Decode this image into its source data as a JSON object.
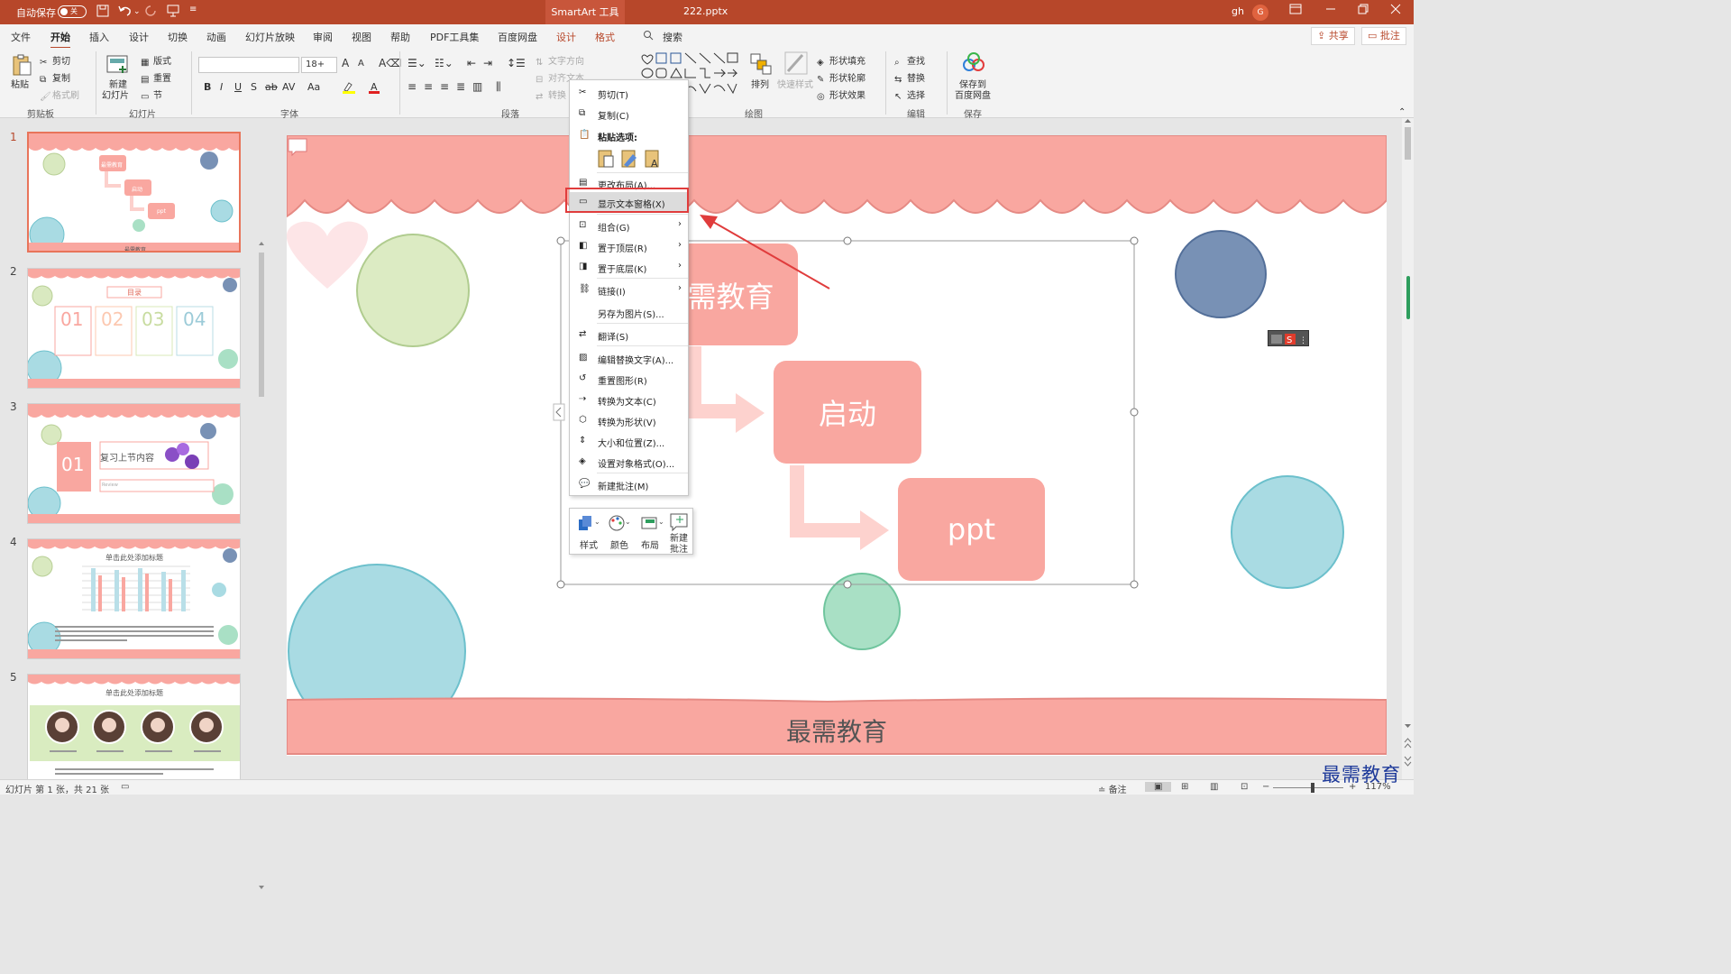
{
  "titlebar": {
    "autosave_label": "自动保存",
    "autosave_state": "关",
    "context_tab": "SmartArt 工具",
    "filename": "222.pptx",
    "user": "gh",
    "avatar_letter": "G"
  },
  "menu": {
    "tabs": [
      "文件",
      "开始",
      "插入",
      "设计",
      "切换",
      "动画",
      "幻灯片放映",
      "审阅",
      "视图",
      "帮助",
      "PDF工具集",
      "百度网盘",
      "设计",
      "格式"
    ],
    "search": "搜索",
    "share": "共享",
    "comment": "批注"
  },
  "ribbon": {
    "clipboard": {
      "paste": "粘贴",
      "cut": "剪切",
      "copy": "复制",
      "format_painter": "格式刷",
      "label": "剪贴板"
    },
    "slides": {
      "new_slide_1": "新建",
      "new_slide_2": "幻灯片",
      "layout": "版式",
      "reset": "重置",
      "section": "节",
      "label": "幻灯片"
    },
    "font": {
      "size": "18+",
      "label": "字体",
      "bold": "B",
      "italic": "I",
      "underline": "U",
      "strike": "S",
      "strike2": "ab",
      "spacing": "AV",
      "case": "Aa",
      "grow": "A",
      "shrink": "A"
    },
    "paragraph": {
      "text_direction": "文字方向",
      "align_text": "对齐文本",
      "convert": "转换",
      "label": "段落"
    },
    "drawing": {
      "arrange": "排列",
      "quick_styles": "快速样式",
      "shape_fill": "形状填充",
      "shape_outline": "形状轮廓",
      "shape_effects": "形状效果",
      "label": "绘图"
    },
    "editing": {
      "find": "查找",
      "replace": "替换",
      "select": "选择",
      "label": "编辑"
    },
    "save": {
      "line1": "保存到",
      "line2": "百度网盘",
      "label": "保存"
    }
  },
  "thumbnails": [
    {
      "num": "1",
      "title": "最需教育",
      "node2": "启动",
      "node3": "ppt",
      "footer": "最需教育"
    },
    {
      "num": "2",
      "title": "目录",
      "items": [
        "01",
        "02",
        "03",
        "04"
      ]
    },
    {
      "num": "3",
      "box": "01",
      "title": "复习上节内容",
      "sub": "Review"
    },
    {
      "num": "4",
      "title": "单击此处添加标题"
    },
    {
      "num": "5",
      "title": "单击此处添加标题"
    }
  ],
  "slide": {
    "node1": "最需教育",
    "node2": "启动",
    "node3": "ppt",
    "footer": "最需教育"
  },
  "context_menu": {
    "cut": "剪切(T)",
    "copy": "复制(C)",
    "paste_options": "粘贴选项:",
    "change_layout": "更改布局(A)...",
    "show_text_pane": "显示文本窗格(X)",
    "group": "组合(G)",
    "bring_front": "置于顶层(R)",
    "send_back": "置于底层(K)",
    "link": "链接(I)",
    "save_as_picture": "另存为图片(S)...",
    "translate": "翻译(S)",
    "edit_alt_text": "编辑替换文字(A)...",
    "reset_graphic": "重置图形(R)",
    "convert_text": "转换为文本(C)",
    "convert_shapes": "转换为形状(V)",
    "size_position": "大小和位置(Z)...",
    "format_object": "设置对象格式(O)...",
    "new_comment": "新建批注(M)"
  },
  "minibar": {
    "style": "样式",
    "color": "颜色",
    "layout": "布局",
    "new_comment_1": "新建",
    "new_comment_2": "批注"
  },
  "status": {
    "slide_info": "幻灯片 第 1 张，共 21 张",
    "notes": "备注",
    "zoom": "117%"
  },
  "watermark": "最需教育",
  "colors": {
    "accent": "#b7472a",
    "node": "#f9a7a0",
    "highlight": "#e03c3c"
  }
}
